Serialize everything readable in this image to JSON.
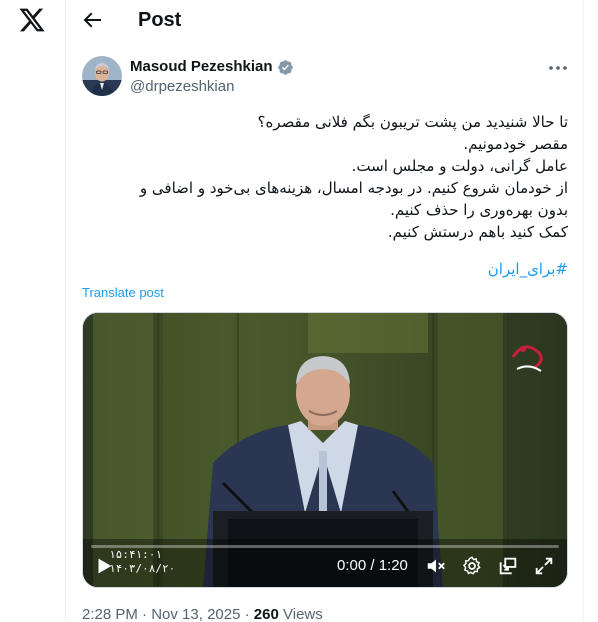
{
  "header": {
    "title": "Post",
    "back_icon": "arrow-left-icon"
  },
  "brand": {
    "logo": "x-logo"
  },
  "author": {
    "name": "Masoud Pezeshkian",
    "handle": "@drpezeshkian",
    "verified": true,
    "verified_color": "#829aab"
  },
  "post": {
    "lines": [
      "تا حالا شنیدید من پشت تریبون بگم فلانی مقصره؟",
      "مقصر خودمونیم.",
      "عامل گرانی، دولت و مجلس است.",
      "از خودمان شروع کنیم. در بودجه امسال، هزینه‌های بی‌خود و اضافی و",
      "بدون بهره‌وری را حذف کنیم.",
      "کمک کنید باهم درستش کنیم."
    ],
    "hashtag": "#برای_ایران",
    "translate_label": "Translate post"
  },
  "video": {
    "time_display": "0:00 / 1:20",
    "progress": 0,
    "overlay_clock": "۱۵:۴۱:۰۱",
    "overlay_date": "۱۴۰۳/۰۸/۲۰",
    "accent": "#1d9bf0",
    "icons": [
      "play-icon",
      "volume-icon",
      "settings-icon",
      "picture-in-picture-icon",
      "fullscreen-icon"
    ]
  },
  "meta": {
    "time": "2:28 PM",
    "date": "Nov 13, 2025",
    "views_count": "260",
    "views_label": "Views",
    "separator": "·"
  },
  "colors": {
    "link": "#1d9bf0",
    "secondary_text": "#536471",
    "primary_text": "#0f1419"
  }
}
